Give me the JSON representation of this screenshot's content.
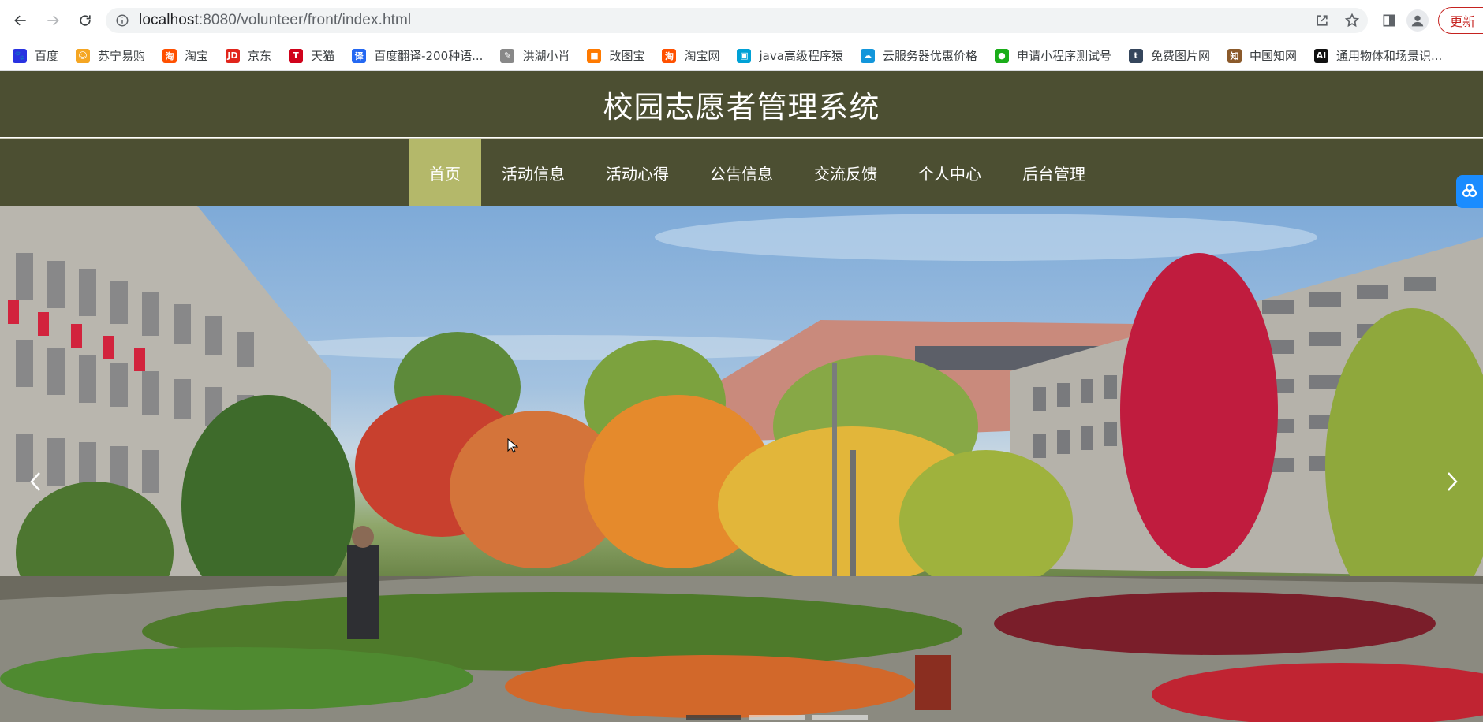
{
  "browser": {
    "url_host": "localhost",
    "url_path": ":8080/volunteer/front/index.html",
    "update_label": "更新"
  },
  "bookmarks": [
    {
      "label": "百度",
      "icon": "baidu-icon",
      "color": "#2932e1",
      "glyph": "🐾"
    },
    {
      "label": "苏宁易购",
      "icon": "suning-icon",
      "color": "#f5a623",
      "glyph": "☺"
    },
    {
      "label": "淘宝",
      "icon": "taobao-icon",
      "color": "#ff5000",
      "glyph": "淘"
    },
    {
      "label": "京东",
      "icon": "jd-icon",
      "color": "#e1251b",
      "glyph": "JD"
    },
    {
      "label": "天猫",
      "icon": "tmall-icon",
      "color": "#d0021b",
      "glyph": "T"
    },
    {
      "label": "百度翻译-200种语...",
      "icon": "baidu-translate-icon",
      "color": "#2468f2",
      "glyph": "译"
    },
    {
      "label": "洪湖小肖",
      "icon": "hhxx-icon",
      "color": "#888888",
      "glyph": "✎"
    },
    {
      "label": "改图宝",
      "icon": "gaitubao-icon",
      "color": "#ff7a00",
      "glyph": "■"
    },
    {
      "label": "淘宝网",
      "icon": "taobao-web-icon",
      "color": "#ff5000",
      "glyph": "淘"
    },
    {
      "label": "java高级程序猿",
      "icon": "bilibili-icon",
      "color": "#00a1d6",
      "glyph": "▣"
    },
    {
      "label": "云服务器优惠价格",
      "icon": "cloud-icon",
      "color": "#1296db",
      "glyph": "☁"
    },
    {
      "label": "申请小程序测试号",
      "icon": "wechat-icon",
      "color": "#1aad19",
      "glyph": "●"
    },
    {
      "label": "免费图片网",
      "icon": "tumblr-icon",
      "color": "#35465c",
      "glyph": "t"
    },
    {
      "label": "中国知网",
      "icon": "cnki-icon",
      "color": "#8b5a2b",
      "glyph": "知"
    },
    {
      "label": "通用物体和场景识...",
      "icon": "ai-icon",
      "color": "#111111",
      "glyph": "AI"
    }
  ],
  "site": {
    "title": "校园志愿者管理系统",
    "nav": [
      {
        "label": "首页",
        "active": true
      },
      {
        "label": "活动信息",
        "active": false
      },
      {
        "label": "活动心得",
        "active": false
      },
      {
        "label": "公告信息",
        "active": false
      },
      {
        "label": "交流反馈",
        "active": false
      },
      {
        "label": "个人中心",
        "active": false
      },
      {
        "label": "后台管理",
        "active": false
      }
    ]
  },
  "colors": {
    "header_bg": "#4c4f32",
    "nav_active_bg": "#b4b86a"
  }
}
